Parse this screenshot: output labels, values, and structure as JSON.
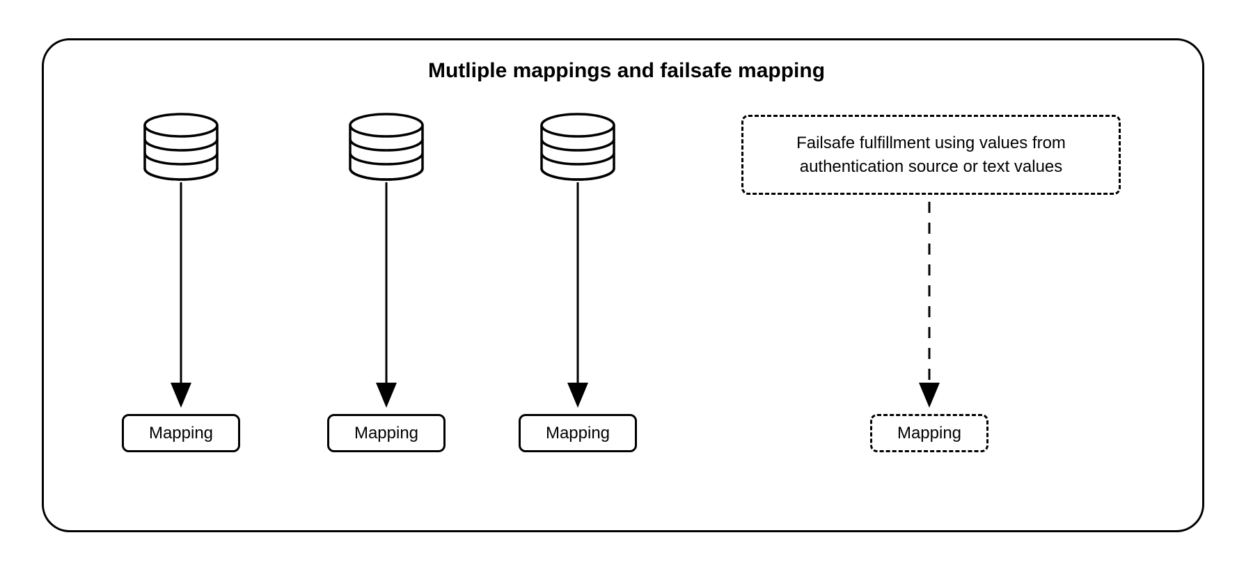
{
  "title": "Mutliple mappings and failsafe mapping",
  "mappings": {
    "m1": "Mapping",
    "m2": "Mapping",
    "m3": "Mapping",
    "m4": "Mapping"
  },
  "failsafe_text": "Failsafe fulfillment using values from authentication source or text values"
}
